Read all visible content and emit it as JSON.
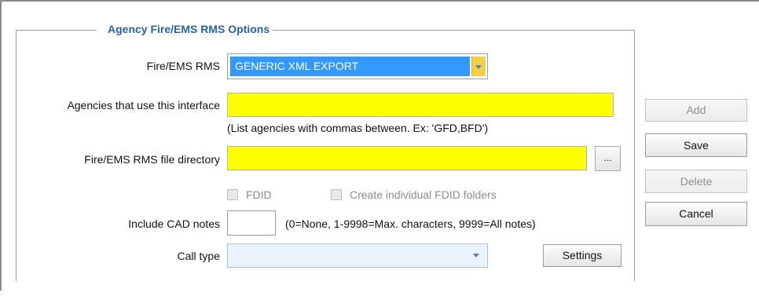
{
  "group": {
    "legend": "Agency Fire/EMS RMS Options"
  },
  "fire_ems_rms": {
    "label": "Fire/EMS RMS",
    "selected": "GENERIC XML EXPORT"
  },
  "agencies": {
    "label": "Agencies that use this interface",
    "value": "",
    "hint": "(List agencies with commas between.  Ex: 'GFD,BFD')"
  },
  "file_dir": {
    "label": "Fire/EMS RMS file directory",
    "value": "",
    "browse_label": "..."
  },
  "fdid": {
    "label": "FDID",
    "checked": false
  },
  "create_fdid": {
    "label": "Create individual FDID folders",
    "checked": false
  },
  "cad_notes": {
    "label": "Include CAD notes",
    "value": "",
    "hint": "(0=None, 1-9998=Max. characters, 9999=All notes)"
  },
  "call_type": {
    "label": "Call type",
    "selected": ""
  },
  "buttons": {
    "settings": "Settings",
    "add": "Add",
    "save": "Save",
    "delete": "Delete",
    "cancel": "Cancel"
  },
  "colors": {
    "legend": "#2563a8",
    "required_field": "#ffff00",
    "selection": "#3399ff"
  }
}
